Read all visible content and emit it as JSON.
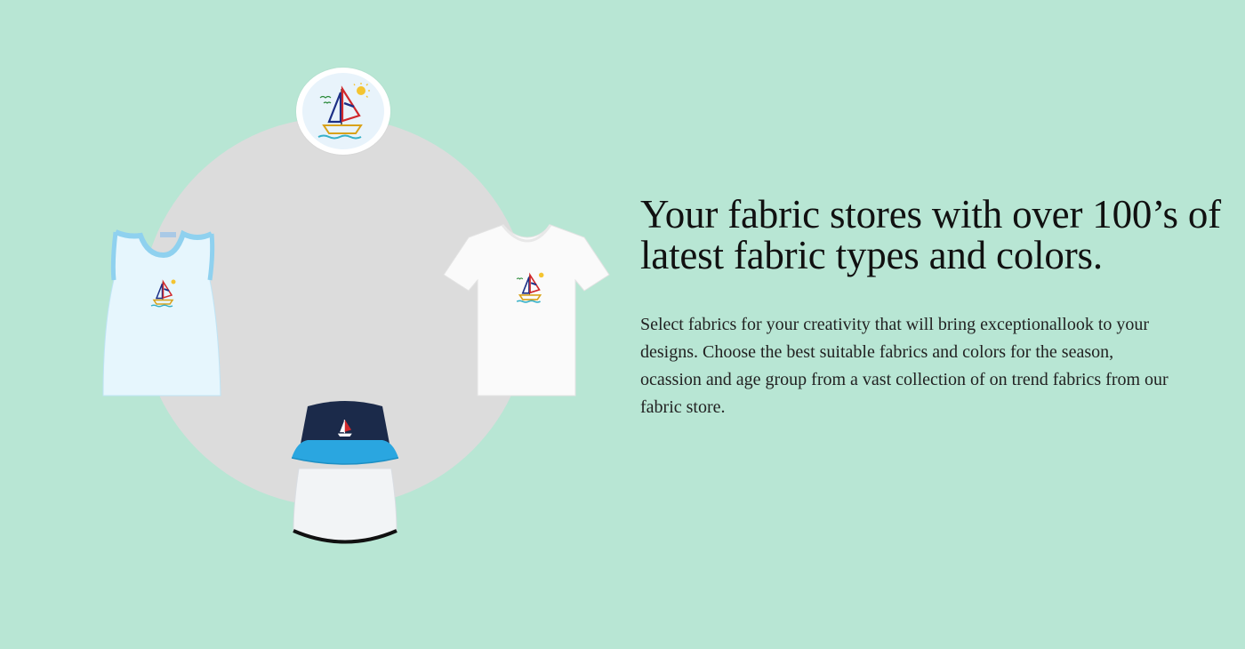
{
  "hero": {
    "headline": "Your fabric stores with over 100’s of latest fabric types and colors.",
    "description": "Select fabrics for your creativity that will bring exceptionallook to your designs. Choose the best suitable fabrics and colors for the season, ocassion and age group from a vast collection of on trend fabrics from our fabric store."
  },
  "colors": {
    "background": "#b8e6d4",
    "circle": "#dcdcdc",
    "hat_navy": "#1b2a4a",
    "hat_blue": "#2aa6e0",
    "trim_blue": "#8fd1ef"
  },
  "icons": [
    "sailboat-badge-icon",
    "tank-top-image",
    "t-shirt-image",
    "bucket-hat-image"
  ]
}
